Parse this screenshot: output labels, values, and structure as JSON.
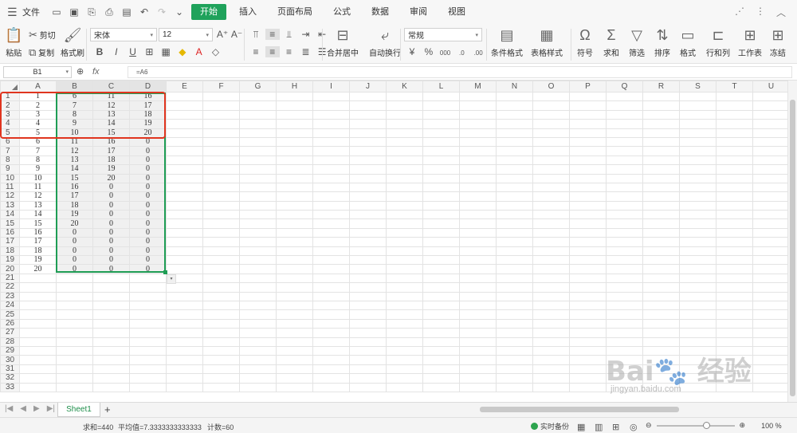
{
  "menubar": {
    "file_label": "文件",
    "tabs": [
      "开始",
      "插入",
      "页面布局",
      "公式",
      "数据",
      "审阅",
      "视图"
    ],
    "active_tab": "开始"
  },
  "ribbon": {
    "paste": "粘贴",
    "cut": "剪切",
    "copy": "复制",
    "format_painter": "格式刷",
    "font_name": "宋体",
    "font_size": "12",
    "merge_center": "合并居中",
    "wrap_text": "自动换行",
    "number_format": "常规",
    "conditional_format": "条件格式",
    "table_style": "表格样式",
    "symbol": "符号",
    "sum": "求和",
    "filter": "筛选",
    "sort": "排序",
    "format": "格式",
    "rows_cols": "行和列",
    "worksheet": "工作表",
    "freeze": "冻结"
  },
  "formula_bar": {
    "name_box": "B1",
    "fx": "fx",
    "formula": "=A6"
  },
  "columns": [
    "A",
    "B",
    "C",
    "D",
    "E",
    "F",
    "G",
    "H",
    "I",
    "J",
    "K",
    "L",
    "M",
    "N",
    "O",
    "P",
    "Q",
    "R",
    "S",
    "T",
    "U"
  ],
  "rows": [
    [
      "1",
      "6",
      "11",
      "16"
    ],
    [
      "2",
      "7",
      "12",
      "17"
    ],
    [
      "3",
      "8",
      "13",
      "18"
    ],
    [
      "4",
      "9",
      "14",
      "19"
    ],
    [
      "5",
      "10",
      "15",
      "20"
    ],
    [
      "6",
      "11",
      "16",
      "0"
    ],
    [
      "7",
      "12",
      "17",
      "0"
    ],
    [
      "8",
      "13",
      "18",
      "0"
    ],
    [
      "9",
      "14",
      "19",
      "0"
    ],
    [
      "10",
      "15",
      "20",
      "0"
    ],
    [
      "11",
      "16",
      "0",
      "0"
    ],
    [
      "12",
      "17",
      "0",
      "0"
    ],
    [
      "13",
      "18",
      "0",
      "0"
    ],
    [
      "14",
      "19",
      "0",
      "0"
    ],
    [
      "15",
      "20",
      "0",
      "0"
    ],
    [
      "16",
      "0",
      "0",
      "0"
    ],
    [
      "17",
      "0",
      "0",
      "0"
    ],
    [
      "18",
      "0",
      "0",
      "0"
    ],
    [
      "19",
      "0",
      "0",
      "0"
    ],
    [
      "20",
      "0",
      "0",
      "0"
    ]
  ],
  "total_rows_visible": 33,
  "sheet": {
    "tab": "Sheet1",
    "add": "+"
  },
  "status": {
    "sum": "求和=440",
    "avg": "平均值=7.3333333333333",
    "count": "计数=60",
    "backup": "实时备份",
    "zoom": "100 %"
  },
  "watermark": {
    "logo": "Bai 经验",
    "site": "jingyan.baidu.com"
  },
  "colors": {
    "accent": "#1fa25b",
    "selection": "#1f9d55",
    "highlight": "#e0351f"
  }
}
